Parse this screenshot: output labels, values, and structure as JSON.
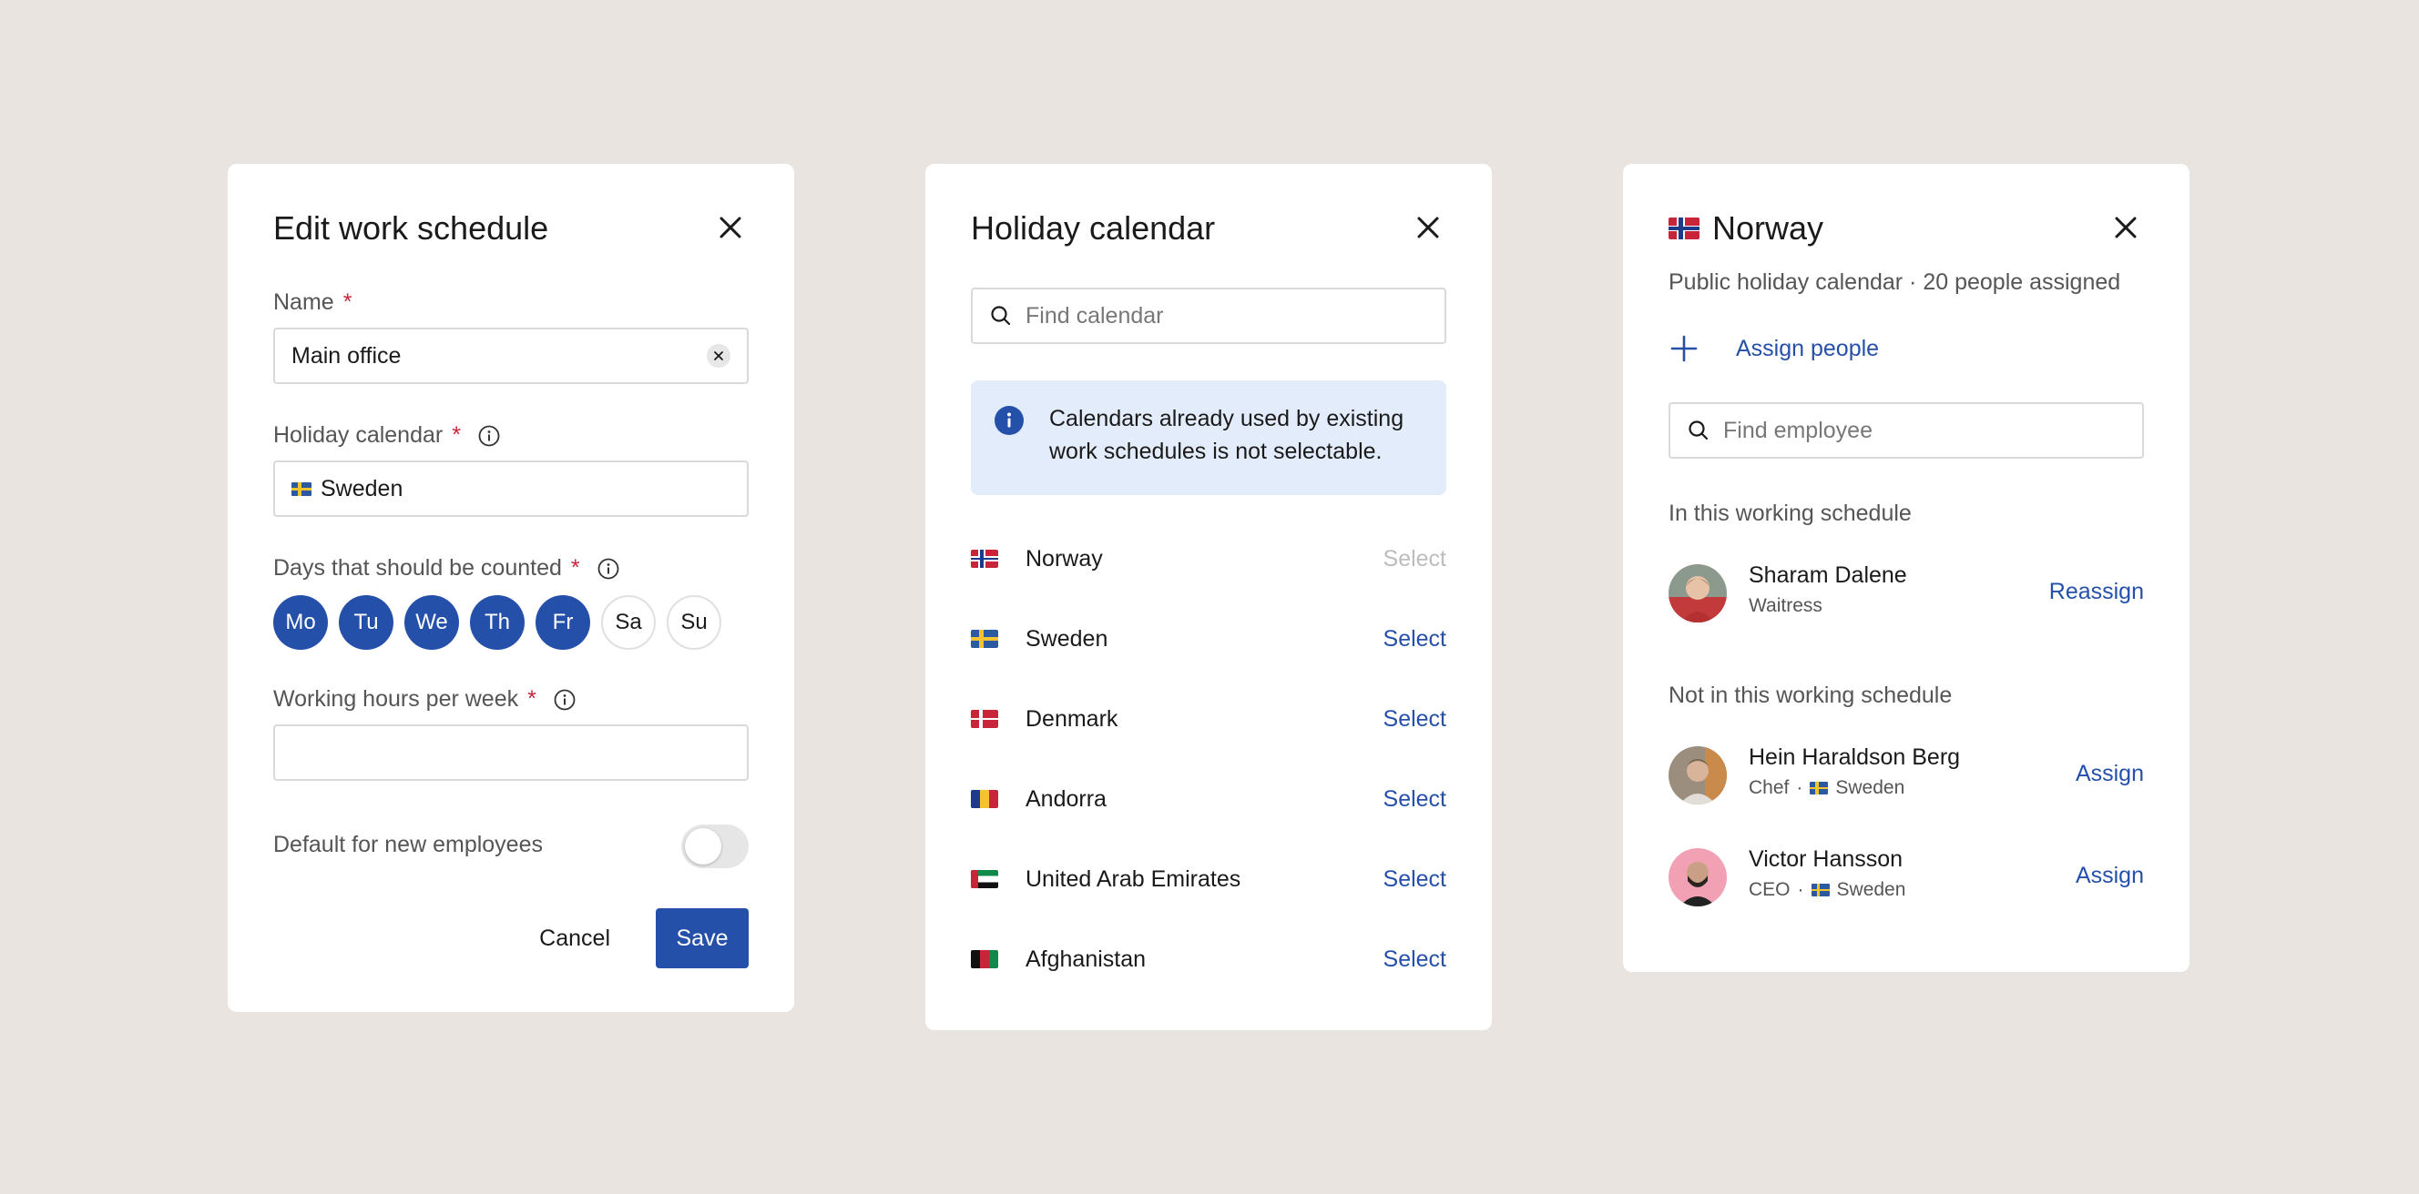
{
  "colors": {
    "background": "#EAE4E0",
    "accent": "#2550A9",
    "required": "#C8253A",
    "info_bg": "#E3ECFB"
  },
  "edit_schedule": {
    "title": "Edit work schedule",
    "name_label": "Name",
    "name_value": "Main office",
    "holiday_label": "Holiday calendar",
    "holiday_value": "Sweden",
    "holiday_flag": "flag-sweden",
    "days_label": "Days that should be counted",
    "days": [
      {
        "label": "Mo",
        "selected": true
      },
      {
        "label": "Tu",
        "selected": true
      },
      {
        "label": "We",
        "selected": true
      },
      {
        "label": "Th",
        "selected": true
      },
      {
        "label": "Fr",
        "selected": true
      },
      {
        "label": "Sa",
        "selected": false
      },
      {
        "label": "Su",
        "selected": false
      }
    ],
    "hours_label": "Working hours per week",
    "hours_value": "",
    "default_label": "Default for new employees",
    "default_on": false,
    "cancel_label": "Cancel",
    "save_label": "Save",
    "required_mark": "*"
  },
  "holiday_calendar": {
    "title": "Holiday calendar",
    "search_placeholder": "Find calendar",
    "info_text": "Calendars already used by existing work schedules is not selectable.",
    "rows": [
      {
        "country": "Norway",
        "flag": "flag-norway",
        "action": "Select",
        "disabled": true
      },
      {
        "country": "Sweden",
        "flag": "flag-sweden",
        "action": "Select",
        "disabled": false
      },
      {
        "country": "Denmark",
        "flag": "flag-denmark",
        "action": "Select",
        "disabled": false
      },
      {
        "country": "Andorra",
        "flag": "flag-andorra",
        "action": "Select",
        "disabled": false
      },
      {
        "country": "United Arab Emirates",
        "flag": "flag-uae",
        "action": "Select",
        "disabled": false
      },
      {
        "country": "Afghanistan",
        "flag": "flag-afghanistan",
        "action": "Select",
        "disabled": false
      }
    ]
  },
  "norway": {
    "title": "Norway",
    "title_flag": "flag-norway",
    "subtitle": "Public holiday calendar · 20 people assigned",
    "assign_people_label": "Assign people",
    "search_placeholder": "Find employee",
    "in_schedule_label": "In this working schedule",
    "not_in_schedule_label": "Not in this working schedule",
    "in_people": [
      {
        "name": "Sharam Dalene",
        "role": "Waitress",
        "action": "Reassign"
      }
    ],
    "out_people": [
      {
        "name": "Hein Haraldson Berg",
        "role": "Chef",
        "separator": "·",
        "country": "Sweden",
        "action": "Assign"
      },
      {
        "name": "Victor Hansson",
        "role": "CEO",
        "separator": "·",
        "country": "Sweden",
        "action": "Assign"
      }
    ]
  }
}
